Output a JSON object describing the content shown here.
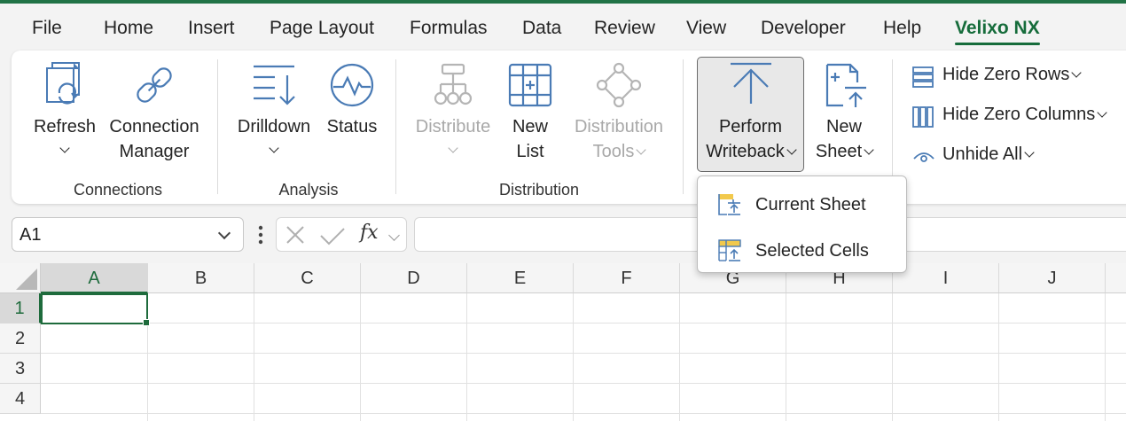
{
  "tabs": [
    "File",
    "Home",
    "Insert",
    "Page Layout",
    "Formulas",
    "Data",
    "Review",
    "View",
    "Developer",
    "Help",
    "Velixo NX"
  ],
  "active_tab": "Velixo NX",
  "ribbon": {
    "connections": {
      "group_label": "Connections",
      "refresh": "Refresh",
      "connection_1": "Connection",
      "connection_2": "Manager"
    },
    "analysis": {
      "group_label": "Analysis",
      "drilldown": "Drilldown",
      "status": "Status"
    },
    "distribution": {
      "group_label": "Distribution",
      "distribute": "Distribute",
      "new_list_1": "New",
      "new_list_2": "List",
      "dist_tools_1": "Distribution",
      "dist_tools_2": "Tools"
    },
    "writeback": {
      "perform_1": "Perform",
      "perform_2": "Writeback",
      "new_sheet_1": "New",
      "new_sheet_2": "Sheet"
    },
    "view": {
      "hide_zero_rows": "Hide Zero Rows",
      "hide_zero_columns": "Hide Zero Columns",
      "unhide_all": "Unhide All"
    }
  },
  "dropdown_menu": {
    "items": [
      "Current Sheet",
      "Selected Cells"
    ]
  },
  "formula_bar": {
    "name_box": "A1",
    "fx_label": "fx",
    "formula": ""
  },
  "sheet": {
    "columns": [
      "A",
      "B",
      "C",
      "D",
      "E",
      "F",
      "G",
      "H",
      "I",
      "J"
    ],
    "rows": [
      "1",
      "2",
      "3",
      "4"
    ],
    "active_cell": "A1"
  },
  "colors": {
    "accent": "#217346",
    "active_tab": "#166c3b",
    "disabled_text": "#a8a8a8",
    "icon_blue": "#4a7bb5",
    "icon_yellow": "#f2c94c"
  }
}
